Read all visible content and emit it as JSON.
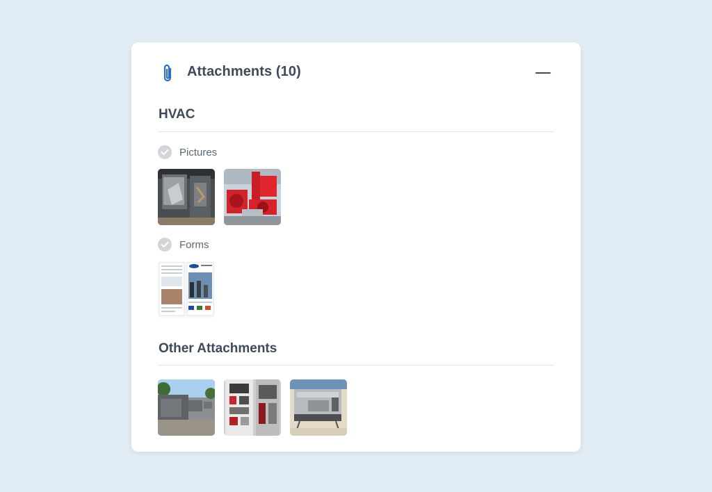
{
  "panel": {
    "title": "Attachments (10)",
    "icon": "paperclip-icon",
    "accent_color": "#2f6fb5",
    "collapse_icon": "minus-icon"
  },
  "sections": [
    {
      "title": "HVAC",
      "groups": [
        {
          "label": "Pictures",
          "icon": "check-circle-icon",
          "thumbnails": [
            "hvac-unit-interior-photo",
            "red-fire-pump-photo"
          ]
        },
        {
          "label": "Forms",
          "icon": "check-circle-icon",
          "thumbnails": [
            "brochure-form-document"
          ]
        }
      ]
    },
    {
      "title": "Other Attachments",
      "thumbnails": [
        "rooftop-units-photo",
        "electrical-panel-photo",
        "rooftop-equipment-photo"
      ]
    }
  ]
}
